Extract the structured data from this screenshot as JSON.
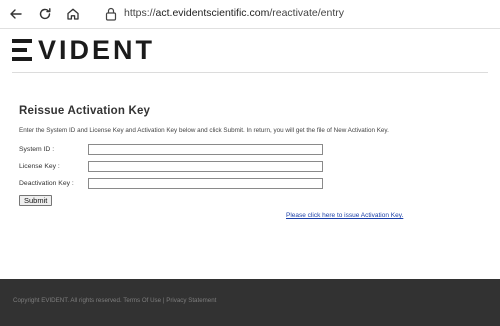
{
  "browser": {
    "url_prefix": "https://",
    "url_host": "act.evidentscientific.com",
    "url_path": "/reactivate/entry"
  },
  "brand": {
    "logo_text": "VIDENT"
  },
  "form": {
    "title": "Reissue Activation Key",
    "intro": "Enter the System ID and License Key and Activation Key below and click Submit. In return, you will get the file of New Activation Key.",
    "system_id_label": "System ID :",
    "license_key_label": "License Key :",
    "deactivation_key_label": "Deactivation Key :",
    "system_id_value": "",
    "license_key_value": "",
    "deactivation_key_value": "",
    "submit_label": "Submit",
    "issue_link": "Please click here to issue Activation Key."
  },
  "footer": {
    "copyright": "Copyright EVIDENT. All rights reserved.",
    "terms": "Terms Of Use",
    "separator": "|",
    "privacy": "Privacy Statement"
  }
}
